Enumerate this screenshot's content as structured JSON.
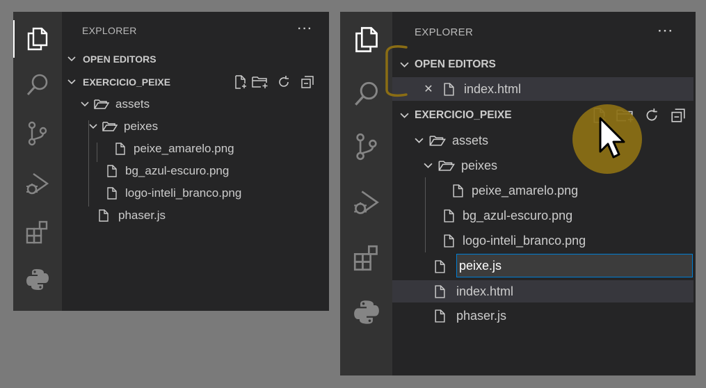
{
  "colors": {
    "background": "#7a7a7a",
    "activity_bar": "#333333",
    "sidebar": "#252526",
    "selection": "#37373d",
    "focus_border": "#007fd4",
    "annotation": "#8a6d14"
  },
  "left_panel": {
    "explorer_title": "EXPLORER",
    "more_actions": "···",
    "sections": {
      "open_editors": "OPEN EDITORS",
      "project": "EXERCICIO_PEIXE"
    },
    "tree": {
      "assets": "assets",
      "peixes": "peixes",
      "peixe_amarelo": "peixe_amarelo.png",
      "bg_azul": "bg_azul-escuro.png",
      "logo": "logo-inteli_branco.png",
      "phaser": "phaser.js"
    }
  },
  "right_panel": {
    "explorer_title": "EXPLORER",
    "more_actions": "···",
    "sections": {
      "open_editors": "OPEN EDITORS",
      "project": "EXERCICIO_PEIXE"
    },
    "open_editor_file": "index.html",
    "close_glyph": "✕",
    "tree": {
      "assets": "assets",
      "peixes": "peixes",
      "peixe_amarelo": "peixe_amarelo.png",
      "bg_azul": "bg_azul-escuro.png",
      "logo": "logo-inteli_branco.png",
      "rename_value": "peixe.js",
      "index": "index.html",
      "phaser": "phaser.js"
    }
  },
  "icons": {
    "activity": [
      "files-icon",
      "search-icon",
      "source-control-icon",
      "run-debug-icon",
      "extensions-icon",
      "python-icon"
    ],
    "toolbar": [
      "new-file-icon",
      "new-folder-icon",
      "refresh-icon",
      "collapse-all-icon"
    ]
  }
}
